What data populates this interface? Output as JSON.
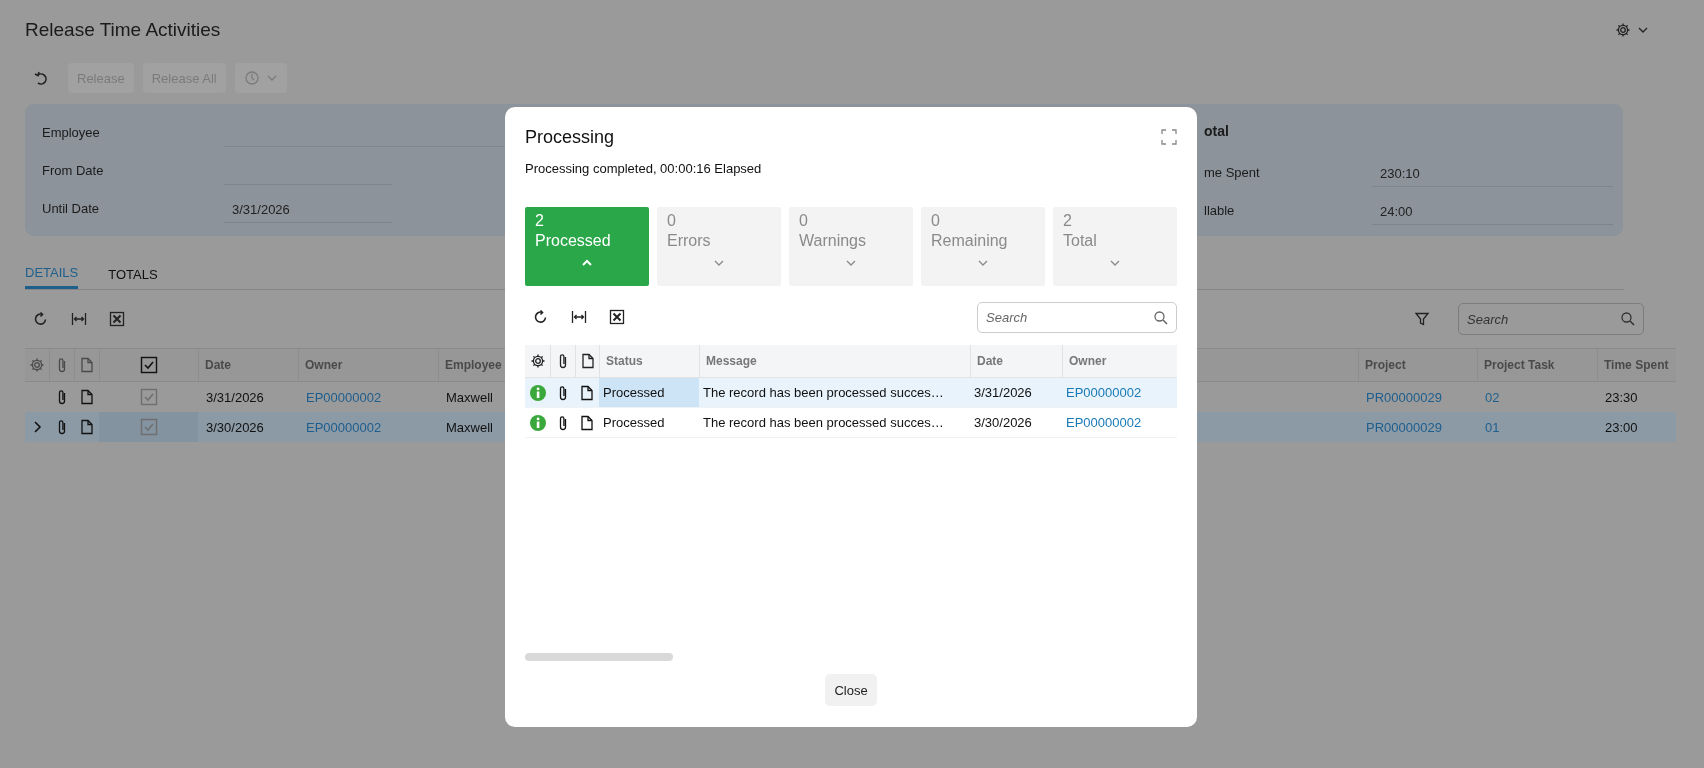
{
  "page": {
    "title": "Release Time Activities"
  },
  "toolbar": {
    "buttons": [
      {
        "kind": "text",
        "label": "Release",
        "disabled": true
      },
      {
        "kind": "text",
        "label": "Release All",
        "disabled": true
      },
      {
        "kind": "menu",
        "disabled": true
      }
    ]
  },
  "filters": [
    {
      "label": "Employee"
    },
    {
      "label": "From Date"
    },
    {
      "label": "Until Date",
      "value": "3/31/2026"
    }
  ],
  "totals": {
    "heading": "otal",
    "fields": [
      {
        "label": "me Spent",
        "value": "230:10"
      },
      {
        "label": "llable",
        "value": "24:00"
      }
    ]
  },
  "tabs": [
    {
      "label": "DETAILS",
      "selected": true
    },
    {
      "label": "TOTALS",
      "selected": false
    }
  ],
  "grid": {
    "search": {
      "placeholder": "Search"
    },
    "header_checked": true,
    "columns": [
      "Date",
      "Owner",
      "Employee",
      "Project",
      "Project Task",
      "Time Spent"
    ],
    "rows": [
      {
        "checked": true,
        "selected": false,
        "date": "3/31/2026",
        "owner": "EP00000002",
        "employee": "Maxwell",
        "project": "PR00000029",
        "task": "02",
        "time_spent": "23:30"
      },
      {
        "checked": true,
        "selected": true,
        "date": "3/30/2026",
        "owner": "EP00000002",
        "employee": "Maxwell",
        "project": "PR00000029",
        "task": "01",
        "time_spent": "23:00"
      }
    ]
  },
  "dialog": {
    "title": "Processing",
    "message": "Processing completed, 00:00:16 Elapsed",
    "tiles": [
      {
        "count": "2",
        "label": "Processed",
        "selected": true
      },
      {
        "count": "0",
        "label": "Errors",
        "selected": false
      },
      {
        "count": "0",
        "label": "Warnings",
        "selected": false
      },
      {
        "count": "0",
        "label": "Remaining",
        "selected": false
      },
      {
        "count": "2",
        "label": "Total",
        "selected": false
      }
    ],
    "search": {
      "placeholder": "Search"
    },
    "columns": [
      "Status",
      "Message",
      "Date",
      "Owner"
    ],
    "rows": [
      {
        "selected": true,
        "status": "Processed",
        "message": "The record has been processed succes…",
        "date": "3/31/2026",
        "owner": "EP00000002"
      },
      {
        "selected": false,
        "status": "Processed",
        "message": "The record has been processed succes…",
        "date": "3/30/2026",
        "owner": "EP00000002"
      }
    ],
    "close": "Close"
  }
}
